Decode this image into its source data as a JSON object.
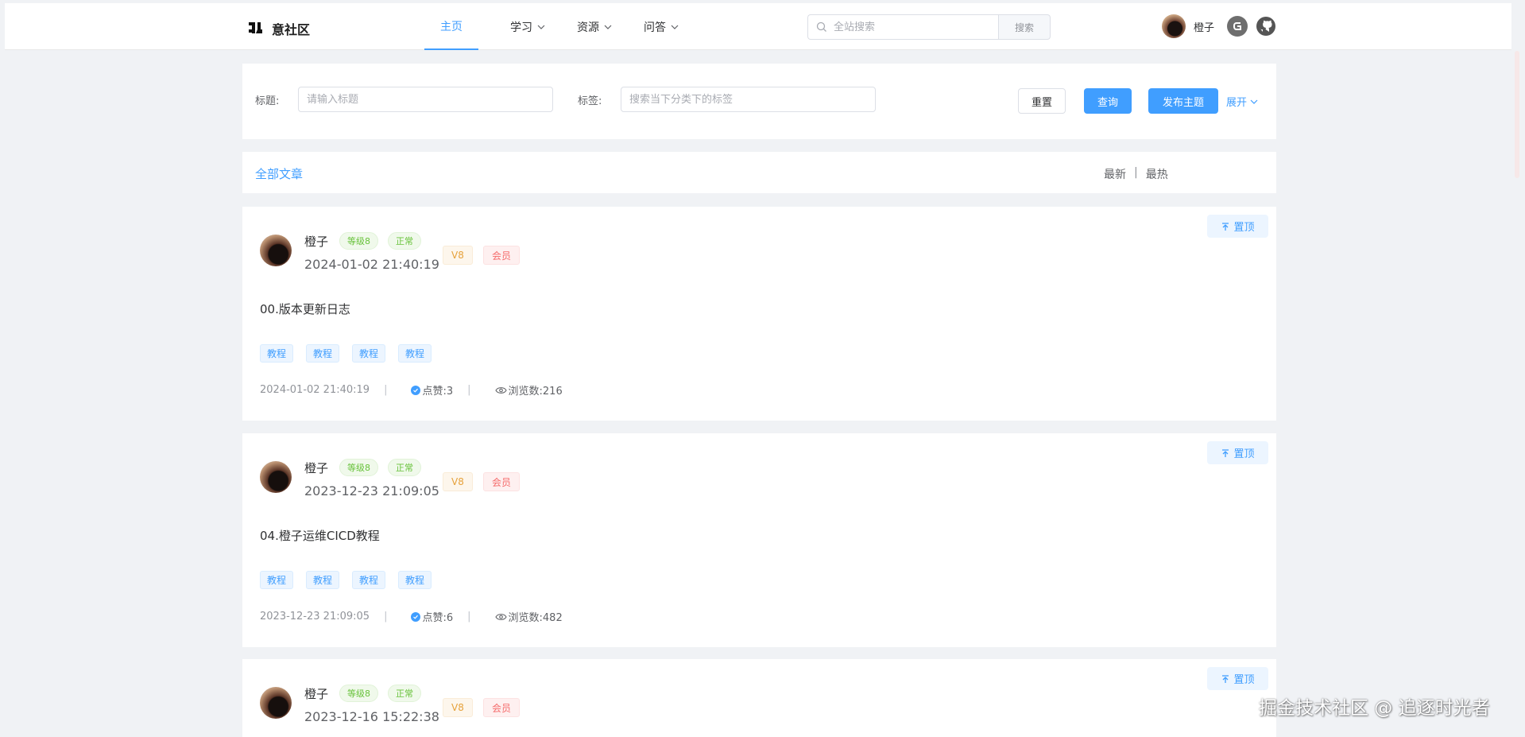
{
  "header": {
    "logo_text": "意社区",
    "nav": [
      {
        "label": "主页"
      },
      {
        "label": "学习"
      },
      {
        "label": "资源"
      },
      {
        "label": "问答"
      }
    ],
    "search": {
      "placeholder": "全站搜索",
      "button": "搜索"
    },
    "user": {
      "name": "橙子"
    }
  },
  "filter": {
    "title_label": "标题:",
    "title_placeholder": "请输入标题",
    "tag_label": "标签:",
    "tag_placeholder": "搜索当下分类下的标签",
    "reset": "重置",
    "query": "查询",
    "publish": "发布主题",
    "expand": "展开"
  },
  "tabs": {
    "all": "全部文章",
    "latest": "最新",
    "separator": "|",
    "hottest": "最热"
  },
  "posts": [
    {
      "pin": "置顶",
      "author": "橙子",
      "level": "等级8",
      "status": "正常",
      "vip": "V8",
      "member": "会员",
      "time": "2024-01-02 21:40:19",
      "title": "00.版本更新日志",
      "tags": [
        "教程",
        "教程",
        "教程",
        "教程"
      ],
      "date": "2024-01-02 21:40:19",
      "likes": "点赞:3",
      "views": "浏览数:216"
    },
    {
      "pin": "置顶",
      "author": "橙子",
      "level": "等级8",
      "status": "正常",
      "vip": "V8",
      "member": "会员",
      "time": "2023-12-23 21:09:05",
      "title": "04.橙子运维CICD教程",
      "tags": [
        "教程",
        "教程",
        "教程",
        "教程"
      ],
      "date": "2023-12-23 21:09:05",
      "likes": "点赞:6",
      "views": "浏览数:482"
    },
    {
      "pin": "置顶",
      "author": "橙子",
      "level": "等级8",
      "status": "正常",
      "vip": "V8",
      "member": "会员",
      "time": "2023-12-16 15:22:38"
    }
  ],
  "meta_separator": "|",
  "watermark": "掘金技术社区 @ 追逐时光者"
}
